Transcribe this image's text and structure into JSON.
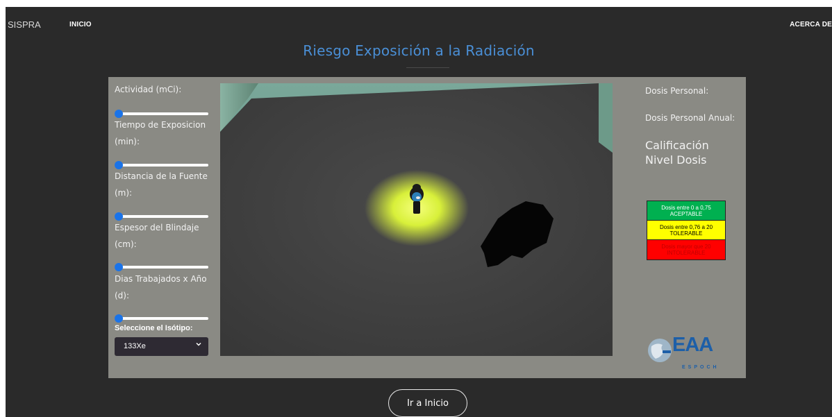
{
  "nav": {
    "brand": "SISPRA",
    "home": "INICIO",
    "about": "ACERCA DE"
  },
  "page": {
    "title": "Riesgo Exposición a la Radiación"
  },
  "controls": {
    "actividad_label": "Actividad (mCi):",
    "actividad_value": 0,
    "tiempo_label": "Tiempo de Exposicion (min):",
    "tiempo_value": 0,
    "distancia_label": "Distancia de la Fuente (m):",
    "distancia_value": 0,
    "espesor_label": "Espesor del Blindaje (cm):",
    "espesor_value": 0,
    "dias_label": "Dias Trabajados x Año (d):",
    "dias_value": 0,
    "isotope_label": "Seleccione el Isótipo:",
    "isotope_selected": "133Xe"
  },
  "results": {
    "dosis_personal": "Dosis Personal:",
    "dosis_anual": "Dosis Personal Anual:",
    "calificacion_line1": "Calificación",
    "calificacion_line2": "Nivel Dosis"
  },
  "legend": [
    {
      "line1": "Dosis entre 0 a 0,75",
      "line2": "ACEPTABLE",
      "color": "#00b050"
    },
    {
      "line1": "Dosis entre 0,76 a 20",
      "line2": "TOLERABLE",
      "color": "#ffff00"
    },
    {
      "line1": "Dosis mayor que 20",
      "line2": "INTOLERABLE",
      "color": "#ff0000"
    }
  ],
  "logo": {
    "text": "EAA",
    "sub": "ESPOCH"
  },
  "cta": {
    "label": "Ir a Inicio"
  },
  "colors": {
    "title_blue": "#4a8fd6",
    "slider_thumb": "#1a73e8",
    "panel_bg": "#8a8a84",
    "page_bg": "#2a2a2a"
  }
}
